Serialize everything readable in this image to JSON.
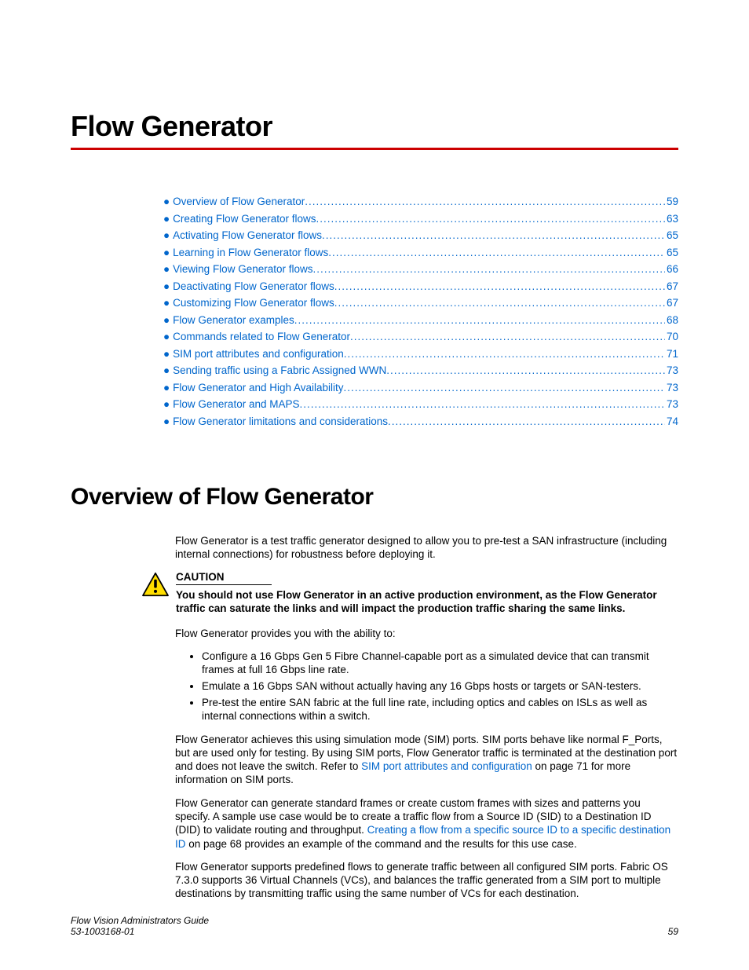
{
  "chapter_title": "Flow Generator",
  "toc": [
    {
      "title": "Overview of Flow Generator ",
      "page": " 59"
    },
    {
      "title": "Creating Flow Generator flows",
      "page": "63"
    },
    {
      "title": "Activating Flow Generator flows",
      "page": "65"
    },
    {
      "title": "Learning in Flow Generator flows",
      "page": " 65"
    },
    {
      "title": "Viewing Flow Generator flows",
      "page": "66"
    },
    {
      "title": "Deactivating Flow Generator flows",
      "page": " 67"
    },
    {
      "title": "Customizing Flow Generator flows",
      "page": " 67"
    },
    {
      "title": "Flow Generator examples ",
      "page": " 68"
    },
    {
      "title": "Commands related to Flow Generator ",
      "page": " 70"
    },
    {
      "title": "SIM port attributes and configuration",
      "page": " 71"
    },
    {
      "title": "Sending traffic using a Fabric Assigned WWN",
      "page": " 73"
    },
    {
      "title": "Flow Generator and High Availability",
      "page": " 73"
    },
    {
      "title": "Flow Generator and MAPS",
      "page": " 73"
    },
    {
      "title": "Flow Generator limitations and considerations",
      "page": " 74"
    }
  ],
  "section_title": "Overview of Flow Generator",
  "intro_para": "Flow Generator is a test traffic generator designed to allow you to pre-test a SAN infrastructure (including internal connections) for robustness before deploying it.",
  "caution_heading": "CAUTION",
  "caution_body": "You should not use Flow Generator in an active production environment, as the Flow Generator traffic can saturate the links and will impact the production traffic sharing the same links.",
  "ability_lead": "Flow Generator provides you with the ability to:",
  "abilities": [
    "Configure a 16 Gbps Gen 5 Fibre Channel-capable port as a simulated device that can transmit frames at full 16 Gbps line rate.",
    "Emulate a 16 Gbps SAN without actually having any 16 Gbps hosts or targets or SAN-testers.",
    "Pre-test the entire SAN fabric at the full line rate, including optics and cables on ISLs as well as internal connections within a switch."
  ],
  "para_sim_a": "Flow Generator achieves this using simulation mode (SIM) ports. SIM ports behave like normal F_Ports, but are used only for testing. By using SIM ports, Flow Generator traffic is terminated at the destination port and does not leave the switch. Refer to ",
  "para_sim_link": "SIM port attributes and configuration",
  "para_sim_b": " on page 71 for more information on SIM ports.",
  "para_frames_a": "Flow Generator can generate standard frames or create custom frames with sizes and patterns you specify. A sample use case would be to create a traffic flow from a Source ID (SID) to a Destination ID (DID) to validate routing and throughput. ",
  "para_frames_link": "Creating a flow from a specific source ID to a specific destination ID",
  "para_frames_b": " on page 68 provides an example of the command and the results for this use case.",
  "para_vc": "Flow Generator supports predefined flows to generate traffic between all configured SIM ports. Fabric OS 7.3.0 supports 36 Virtual Channels (VCs), and balances the traffic generated from a SIM port to multiple destinations by transmitting traffic using the same number of VCs for each destination.",
  "footer_title": "Flow Vision Administrators Guide",
  "footer_doc": "53-1003168-01",
  "footer_page": "59"
}
